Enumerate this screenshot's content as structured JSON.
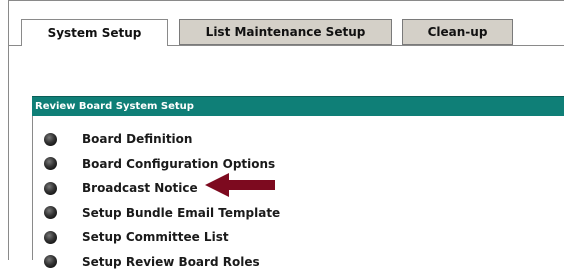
{
  "tabs": [
    {
      "label": "System Setup",
      "active": true
    },
    {
      "label": "List Maintenance Setup",
      "active": false
    },
    {
      "label": "Clean-up",
      "active": false
    }
  ],
  "panel": {
    "title": "Review Board System Setup",
    "header_color": "#0f7f77",
    "items": [
      {
        "label": "Board Definition"
      },
      {
        "label": "Board Configuration Options"
      },
      {
        "label": "Broadcast Notice"
      },
      {
        "label": "Setup Bundle Email Template"
      },
      {
        "label": "Setup Committee List"
      },
      {
        "label": "Setup Review Board Roles"
      }
    ]
  },
  "annotation": {
    "icon": "arrow-left-icon",
    "color": "#7d0a1f",
    "points_to": "Broadcast Notice"
  }
}
